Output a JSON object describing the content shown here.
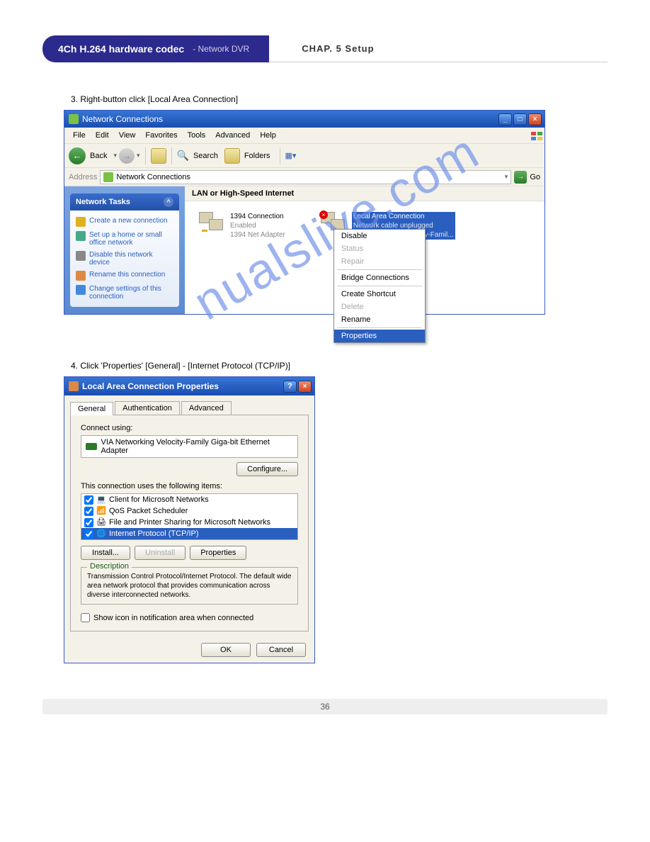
{
  "header": {
    "title": "4Ch H.264 hardware codec",
    "subtitle": "- Network DVR",
    "chapter": "CHAP. 5 Setup"
  },
  "steps": {
    "s3": "3. Right-button click [Local Area Connection]",
    "s4": "4. Click 'Properties' [General] - [Internet Protocol (TCP/IP)]"
  },
  "win1": {
    "title": "Network Connections",
    "menu": [
      "File",
      "Edit",
      "View",
      "Favorites",
      "Tools",
      "Advanced",
      "Help"
    ],
    "toolbar": {
      "back": "Back",
      "search": "Search",
      "folders": "Folders"
    },
    "address": {
      "label": "Address",
      "value": "Network Connections",
      "go": "Go"
    },
    "tasks": {
      "header": "Network Tasks",
      "items": [
        "Create a new connection",
        "Set up a home or small office network",
        "Disable this network device",
        "Rename this connection",
        "Change settings of this connection"
      ]
    },
    "section": "LAN or High-Speed Internet",
    "conn1": {
      "l1": "1394 Connection",
      "l2": "Enabled",
      "l3": "1394 Net Adapter"
    },
    "conn2": {
      "l1": "Local Area Connection",
      "l2": "Network cable unplugged",
      "l3": "VIA Networking Velocity-Famil..."
    },
    "ctx": {
      "disable": "Disable",
      "status": "Status",
      "repair": "Repair",
      "bridge": "Bridge Connections",
      "shortcut": "Create Shortcut",
      "delete": "Delete",
      "rename": "Rename",
      "properties": "Properties"
    }
  },
  "dlg": {
    "title": "Local Area Connection Properties",
    "tabs": [
      "General",
      "Authentication",
      "Advanced"
    ],
    "connect_using": "Connect using:",
    "adapter": "VIA Networking Velocity-Family Giga-bit Ethernet Adapter",
    "configure": "Configure...",
    "items_label": "This connection uses the following items:",
    "items": [
      "Client for Microsoft Networks",
      "QoS Packet Scheduler",
      "File and Printer Sharing for Microsoft Networks",
      "Internet Protocol (TCP/IP)"
    ],
    "install": "Install...",
    "uninstall": "Uninstall",
    "properties": "Properties",
    "desc_label": "Description",
    "desc": "Transmission Control Protocol/Internet Protocol. The default wide area network protocol that provides communication across diverse interconnected networks.",
    "show_icon": "Show icon in notification area when connected",
    "ok": "OK",
    "cancel": "Cancel"
  },
  "watermark": "nualslive.com",
  "page_number": "36"
}
